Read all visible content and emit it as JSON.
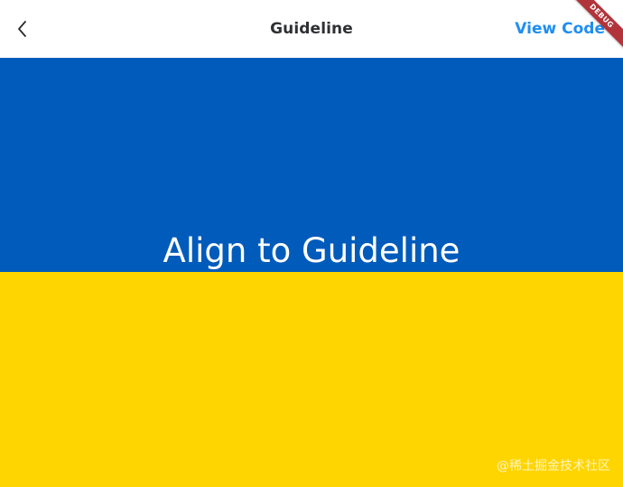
{
  "appbar": {
    "back_icon": "chevron-left-icon",
    "title": "Guideline",
    "view_code_label": "View Code",
    "debug_label": "DEBUG"
  },
  "content": {
    "guideline_text": "Align to Guideline",
    "watermark": "@稀土掘金技术社区"
  },
  "colors": {
    "flag_top": "#005bbb",
    "flag_bottom": "#ffd500",
    "title_text": "#2f3035",
    "accent": "#1f8ef1",
    "debug_ribbon": "#b1343a",
    "content_text": "#ffffff"
  }
}
